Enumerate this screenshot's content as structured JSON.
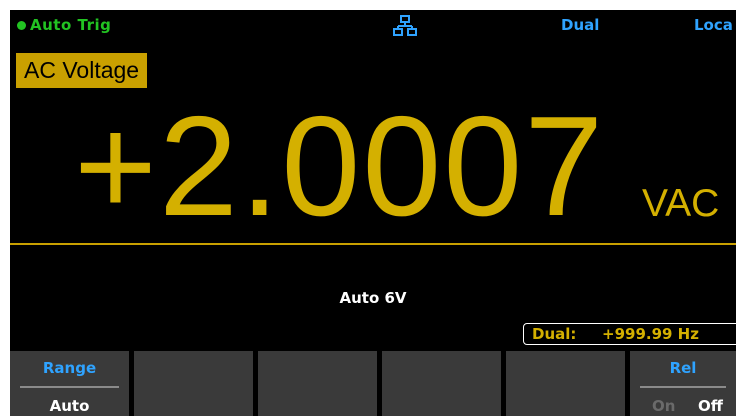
{
  "status": {
    "trigger": "Auto  Trig",
    "network_icon": "network-icon",
    "mode": "Dual",
    "remote": "Loca"
  },
  "measurement": {
    "function": "AC Voltage",
    "value": "+2.0007",
    "unit": "VAC",
    "range": "Auto  6V"
  },
  "dual": {
    "label": "Dual:",
    "value": "+999.99  Hz"
  },
  "softkeys": [
    {
      "title": "Range",
      "value": "Auto"
    },
    {
      "title": "",
      "value": ""
    },
    {
      "title": "",
      "value": ""
    },
    {
      "title": "",
      "value": ""
    },
    {
      "title": "",
      "value": ""
    },
    {
      "title": "Rel",
      "on": "On",
      "off": "Off"
    }
  ],
  "colors": {
    "accent_yellow": "#d4b000",
    "label_yellow": "#c9a000",
    "status_green": "#22c322",
    "status_blue": "#2fa3ff",
    "softkey_gray": "#3a3a3a"
  }
}
